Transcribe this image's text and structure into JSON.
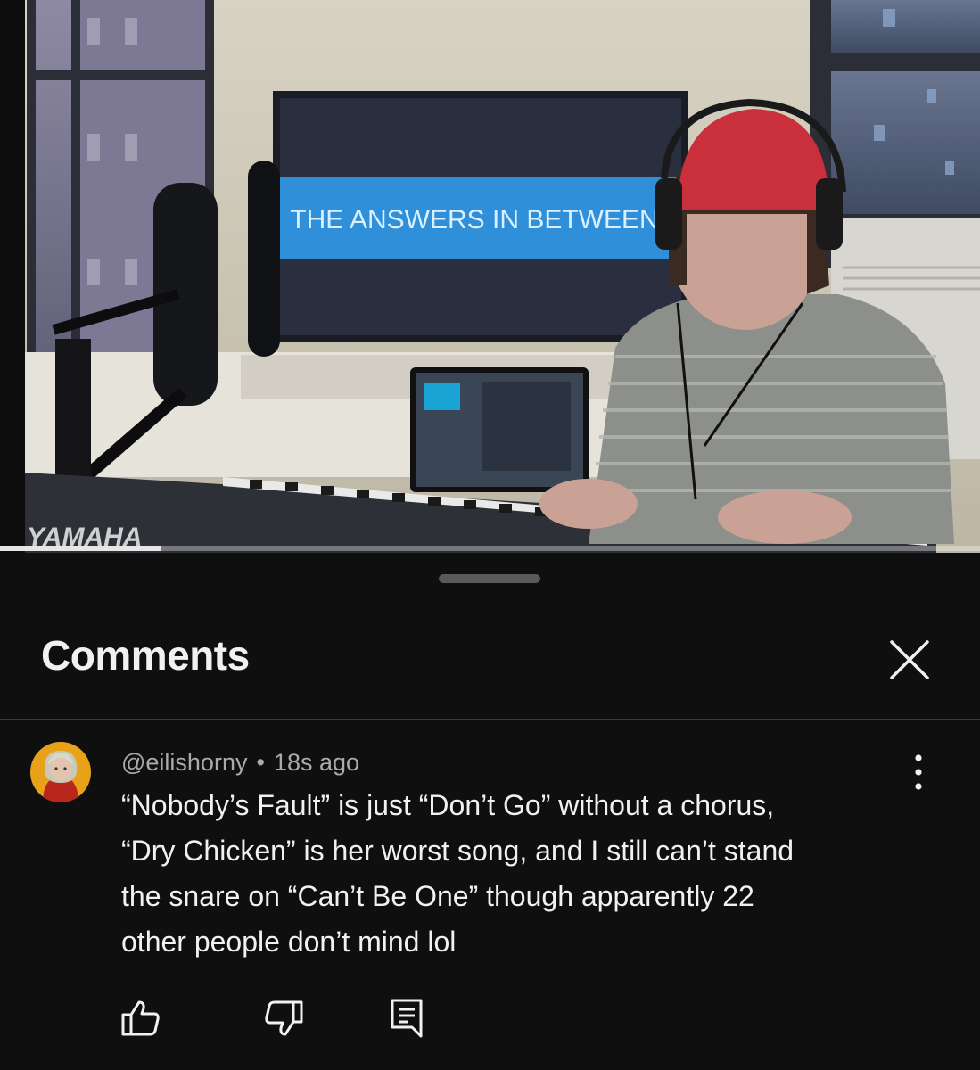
{
  "video": {
    "screen_text": "THE ANSWERS IN BETWEEN",
    "keyboard_brand": "YAMAHA",
    "progress_fraction": 0.165
  },
  "comments_panel": {
    "title": "Comments",
    "close_icon": "close-icon"
  },
  "comment": {
    "author": "@eilishorny",
    "separator": "•",
    "time": "18s ago",
    "lines": [
      "“Nobody’s Fault” is just “Don’t Go” without a chorus,",
      "“Dry Chicken” is her worst song, and I still can’t stand",
      "the snare on “Can’t Be One” though apparently 22",
      "other people don’t mind lol"
    ],
    "actions": [
      "thumbs-up-icon",
      "thumbs-down-icon",
      "reply-icon"
    ],
    "menu_icon": "more-vertical-icon"
  },
  "colors": {
    "background": "#0f0f0f",
    "text_primary": "#f1f1f1",
    "text_secondary": "#aaaaaa",
    "divider": "#3a3a3a"
  }
}
